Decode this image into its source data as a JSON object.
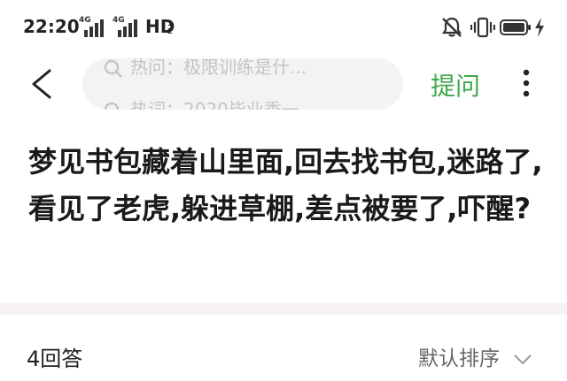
{
  "status_bar": {
    "time": "22:20",
    "network_1": "4G",
    "network_2": "4G",
    "hd": "HD",
    "hd_sub_top": "1",
    "hd_sub_bottom": "2",
    "icons": [
      "signal-icon",
      "mute-icon",
      "vibrate-icon",
      "battery-icon",
      "charging-icon"
    ]
  },
  "header": {
    "search_hints": [
      "热问：极限训练是什...",
      "热词：2020毕业季一"
    ],
    "ask_label": "提问",
    "icons": [
      "back-arrow-icon",
      "search-icon",
      "more-vertical-icon"
    ]
  },
  "question": {
    "title": "梦见书包藏着山里面,回去找书包,迷路了,看见了老虎,躲进草棚,差点被要了,吓醒?"
  },
  "answers_bar": {
    "count_label": "4回答",
    "sort_label": "默认排序",
    "icons": [
      "chevron-down-icon"
    ]
  },
  "colors": {
    "accent_green": "#3ea84a",
    "search_bg": "#f3f3f3",
    "divider": "#f6f1f5"
  }
}
